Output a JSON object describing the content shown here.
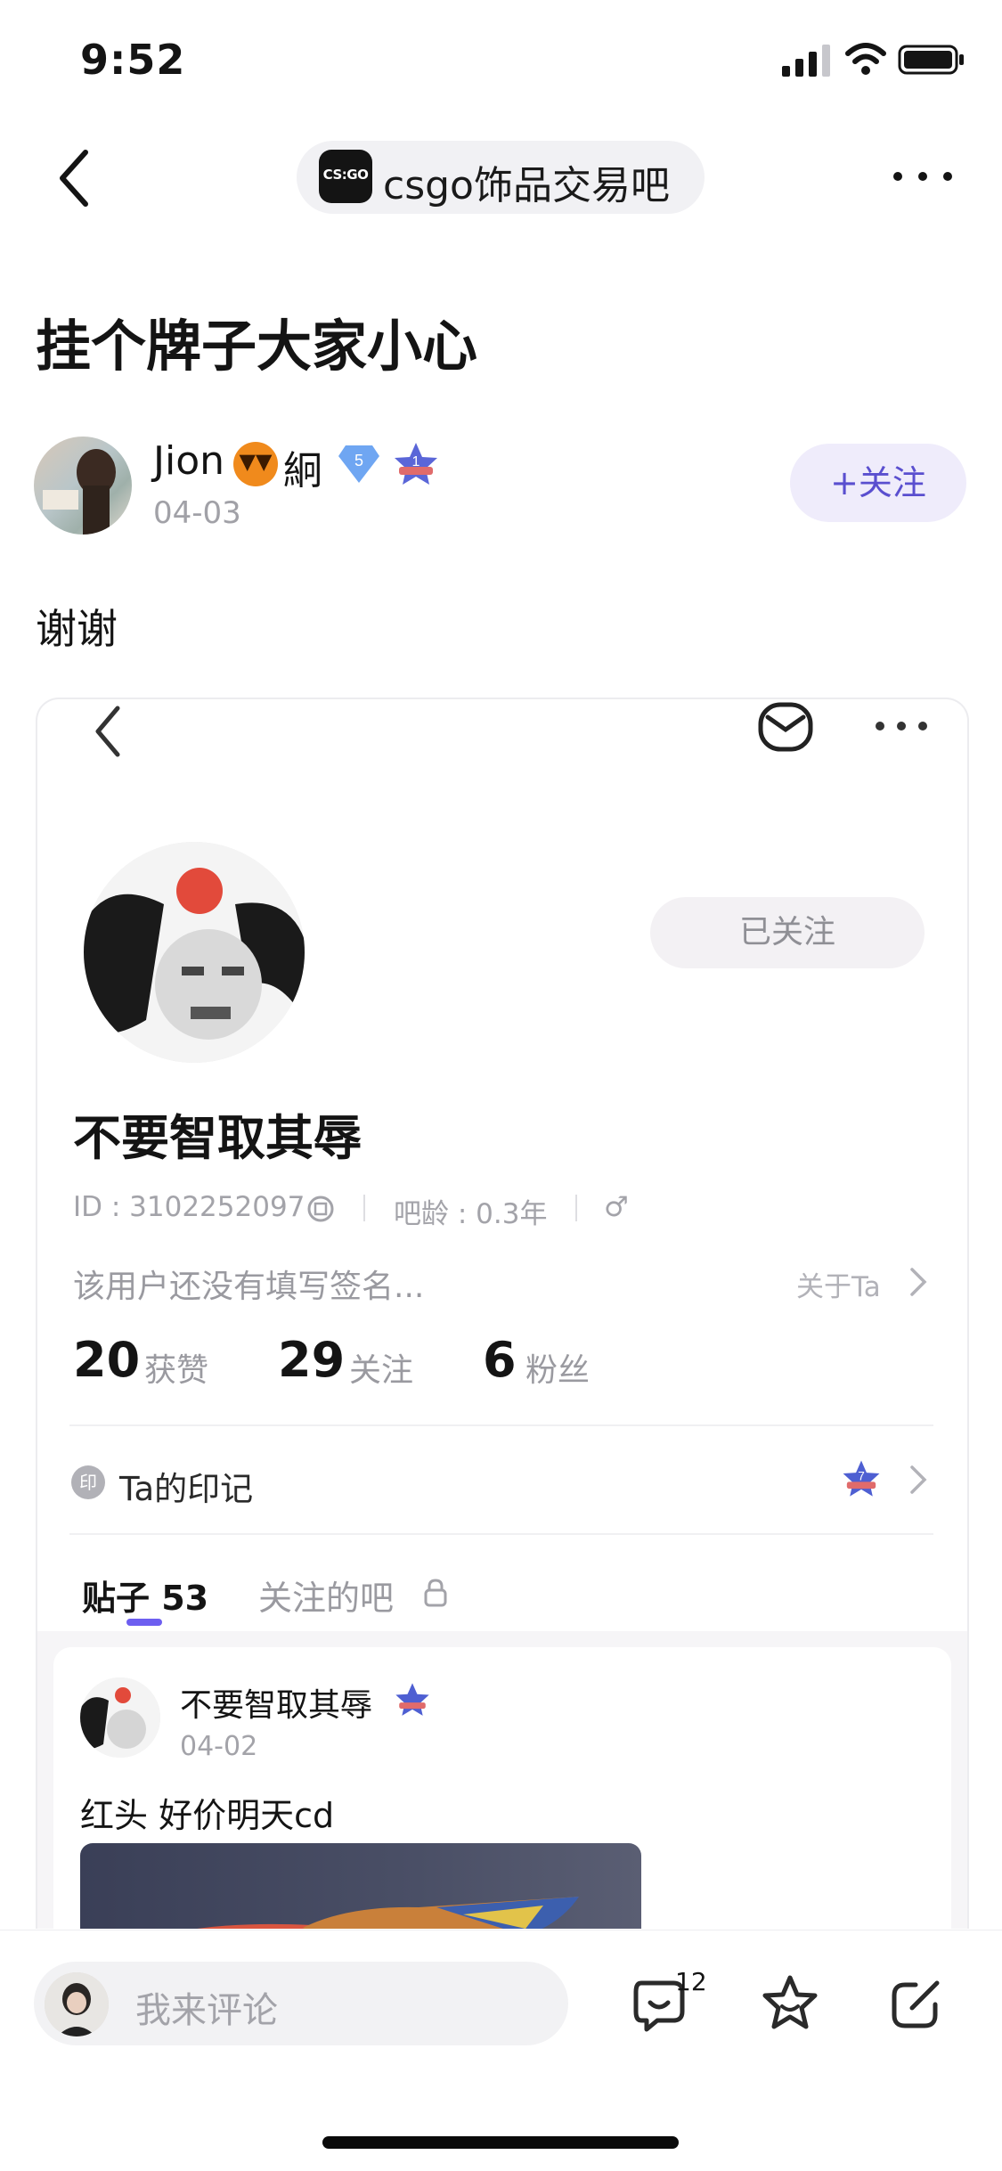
{
  "status_bar": {
    "time": "9:52"
  },
  "nav": {
    "forum_name": "csgo饰品交易吧",
    "forum_logo_text": "CS:GO"
  },
  "post": {
    "title": "挂个牌子大家小心",
    "body": "谢谢"
  },
  "author": {
    "name": "Jion",
    "name_tail": "絅",
    "date": "04-03",
    "gem_level": "5",
    "star_level": "1",
    "follow_label": "+关注"
  },
  "embedded": {
    "name": "不要智取其辱",
    "followed_label": "已关注",
    "id_text": "ID : 3102252097",
    "age_text": "吧龄 : 0.3年",
    "gender_symbol": "♂",
    "signature": "该用户还没有填写签名...",
    "about": "关于Ta",
    "stats": [
      {
        "value": "20",
        "label": "获赞"
      },
      {
        "value": "29",
        "label": "关注"
      },
      {
        "value": "6",
        "label": "粉丝"
      }
    ],
    "seal_icon_text": "印",
    "seal_label": "Ta的印记",
    "seal_level": "7",
    "tabs": [
      {
        "label": "贴子 53"
      },
      {
        "label": "关注的吧"
      }
    ],
    "card": {
      "name": "不要智取其辱",
      "date": "04-02",
      "text": "红头  好价明天cd"
    }
  },
  "bottom": {
    "comment_placeholder": "我来评论",
    "comment_count": "12"
  },
  "colors": {
    "accent": "#6d5ef0",
    "follow_text": "#5a4fcf",
    "follow_bg": "#efecfb"
  }
}
